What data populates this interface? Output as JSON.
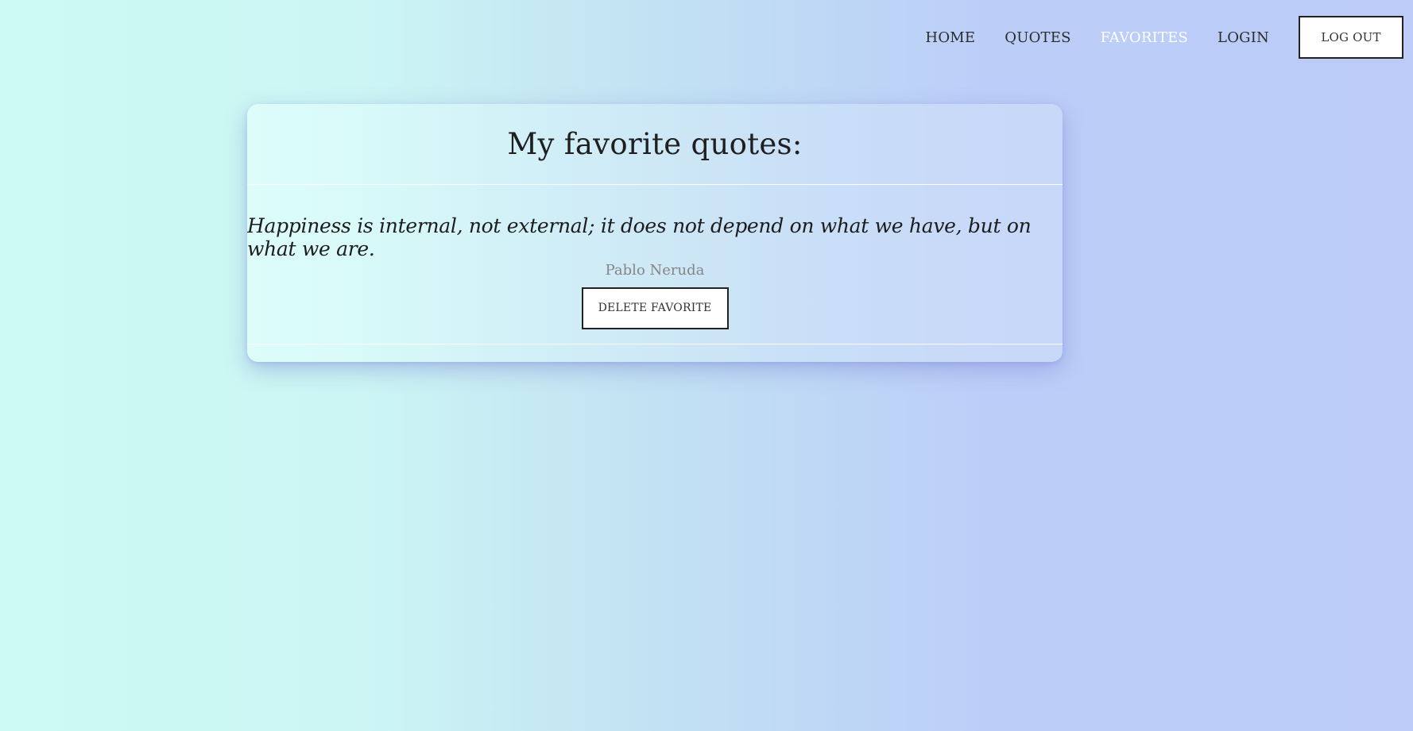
{
  "nav": {
    "items": [
      {
        "label": "HOME"
      },
      {
        "label": "QUOTES"
      },
      {
        "label": "FAVORITES",
        "active": true
      },
      {
        "label": "LOGIN"
      }
    ],
    "logout_label": "LOG OUT"
  },
  "main": {
    "title": "My favorite quotes:",
    "quotes": [
      {
        "text": "Happiness is internal, not external; it does not depend on what we have, but on what we are.",
        "author": "Pablo Neruda",
        "delete_label": "DELETE FAVORITE"
      }
    ]
  },
  "colors": {
    "background_start": "#ccfaf4",
    "background_end": "#bccbf8",
    "active_nav": "#ffffff",
    "text": "#222222",
    "author": "#858585"
  }
}
